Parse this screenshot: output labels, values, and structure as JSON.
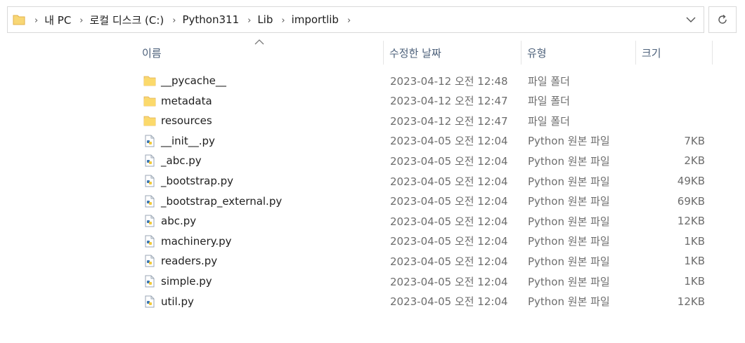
{
  "address_bar": {
    "breadcrumbs": [
      "내 PC",
      "로컬 디스크 (C:)",
      "Python311",
      "Lib",
      "importlib"
    ]
  },
  "columns": {
    "name": "이름",
    "date": "수정한 날짜",
    "type": "유형",
    "size": "크기"
  },
  "files": [
    {
      "name": "__pycache__",
      "date": "2023-04-12 오전 12:48",
      "type": "파일 폴더",
      "size": "",
      "icon": "folder-icon"
    },
    {
      "name": "metadata",
      "date": "2023-04-12 오전 12:47",
      "type": "파일 폴더",
      "size": "",
      "icon": "folder-icon"
    },
    {
      "name": "resources",
      "date": "2023-04-12 오전 12:47",
      "type": "파일 폴더",
      "size": "",
      "icon": "folder-icon"
    },
    {
      "name": "__init__.py",
      "date": "2023-04-05 오전 12:04",
      "type": "Python 원본 파일",
      "size": "7KB",
      "icon": "python-file-icon"
    },
    {
      "name": "_abc.py",
      "date": "2023-04-05 오전 12:04",
      "type": "Python 원본 파일",
      "size": "2KB",
      "icon": "python-file-icon"
    },
    {
      "name": "_bootstrap.py",
      "date": "2023-04-05 오전 12:04",
      "type": "Python 원본 파일",
      "size": "49KB",
      "icon": "python-file-icon"
    },
    {
      "name": "_bootstrap_external.py",
      "date": "2023-04-05 오전 12:04",
      "type": "Python 원본 파일",
      "size": "69KB",
      "icon": "python-file-icon"
    },
    {
      "name": "abc.py",
      "date": "2023-04-05 오전 12:04",
      "type": "Python 원본 파일",
      "size": "12KB",
      "icon": "python-file-icon"
    },
    {
      "name": "machinery.py",
      "date": "2023-04-05 오전 12:04",
      "type": "Python 원본 파일",
      "size": "1KB",
      "icon": "python-file-icon"
    },
    {
      "name": "readers.py",
      "date": "2023-04-05 오전 12:04",
      "type": "Python 원본 파일",
      "size": "1KB",
      "icon": "python-file-icon"
    },
    {
      "name": "simple.py",
      "date": "2023-04-05 오전 12:04",
      "type": "Python 원본 파일",
      "size": "1KB",
      "icon": "python-file-icon"
    },
    {
      "name": "util.py",
      "date": "2023-04-05 오전 12:04",
      "type": "Python 원본 파일",
      "size": "12KB",
      "icon": "python-file-icon"
    }
  ],
  "colors": {
    "folder": "#f8d775",
    "folder_dark": "#e8b84a",
    "header_text": "#4c607a",
    "detail_text": "#6d6d6d",
    "border": "#d9d9d9"
  }
}
